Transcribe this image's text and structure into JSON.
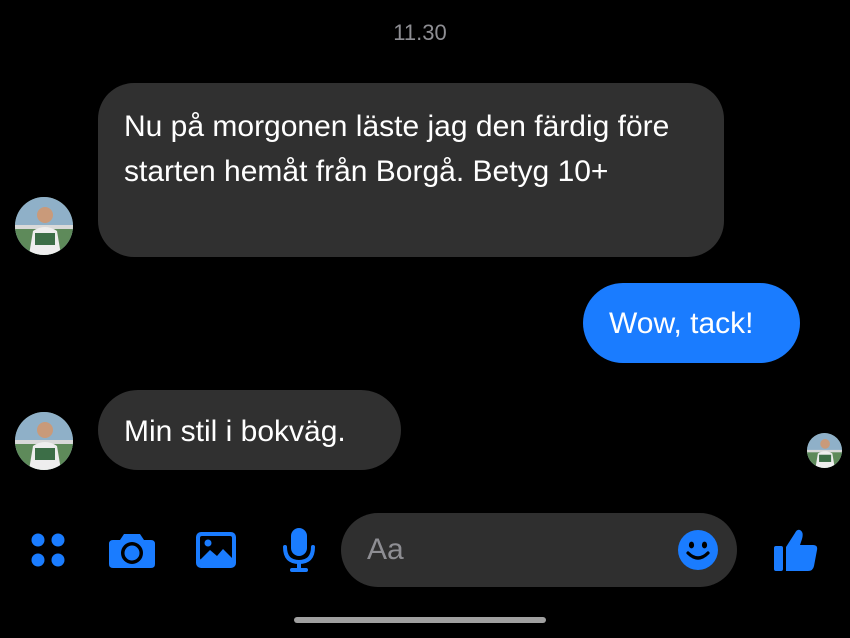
{
  "conversation": {
    "timestamp": "11.30",
    "messages": [
      {
        "direction": "incoming",
        "text": "Nu på morgonen läste jag den färdig före starten hemåt från Borgå. Betyg 10+"
      },
      {
        "direction": "outgoing",
        "text": "Wow, tack!"
      },
      {
        "direction": "incoming",
        "text": "Min stil i bokväg."
      }
    ]
  },
  "composer": {
    "placeholder": "Aa",
    "value": "",
    "icons": [
      "more-apps-icon",
      "camera-icon",
      "gallery-icon",
      "microphone-icon",
      "emoji-icon",
      "thumbs-up-icon"
    ]
  },
  "colors": {
    "background": "#000000",
    "incoming_bubble": "#303030",
    "outgoing_bubble": "#1a7cff",
    "accent": "#1a7cff",
    "composer_field": "#2f2f2f",
    "timestamp": "#8e8e93"
  }
}
